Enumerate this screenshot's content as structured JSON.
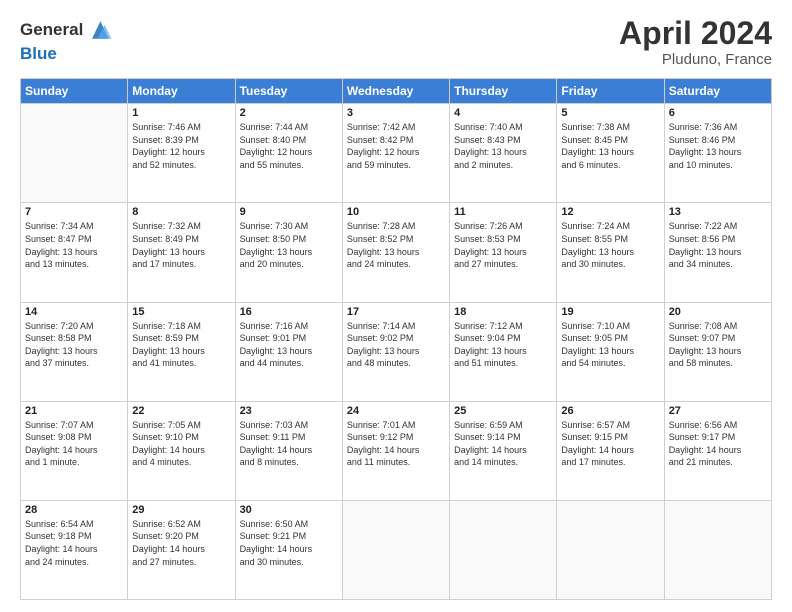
{
  "header": {
    "logo_general": "General",
    "logo_blue": "Blue",
    "month": "April 2024",
    "location": "Pluduno, France"
  },
  "weekdays": [
    "Sunday",
    "Monday",
    "Tuesday",
    "Wednesday",
    "Thursday",
    "Friday",
    "Saturday"
  ],
  "weeks": [
    [
      {
        "day": "",
        "info": ""
      },
      {
        "day": "1",
        "info": "Sunrise: 7:46 AM\nSunset: 8:39 PM\nDaylight: 12 hours\nand 52 minutes."
      },
      {
        "day": "2",
        "info": "Sunrise: 7:44 AM\nSunset: 8:40 PM\nDaylight: 12 hours\nand 55 minutes."
      },
      {
        "day": "3",
        "info": "Sunrise: 7:42 AM\nSunset: 8:42 PM\nDaylight: 12 hours\nand 59 minutes."
      },
      {
        "day": "4",
        "info": "Sunrise: 7:40 AM\nSunset: 8:43 PM\nDaylight: 13 hours\nand 2 minutes."
      },
      {
        "day": "5",
        "info": "Sunrise: 7:38 AM\nSunset: 8:45 PM\nDaylight: 13 hours\nand 6 minutes."
      },
      {
        "day": "6",
        "info": "Sunrise: 7:36 AM\nSunset: 8:46 PM\nDaylight: 13 hours\nand 10 minutes."
      }
    ],
    [
      {
        "day": "7",
        "info": "Sunrise: 7:34 AM\nSunset: 8:47 PM\nDaylight: 13 hours\nand 13 minutes."
      },
      {
        "day": "8",
        "info": "Sunrise: 7:32 AM\nSunset: 8:49 PM\nDaylight: 13 hours\nand 17 minutes."
      },
      {
        "day": "9",
        "info": "Sunrise: 7:30 AM\nSunset: 8:50 PM\nDaylight: 13 hours\nand 20 minutes."
      },
      {
        "day": "10",
        "info": "Sunrise: 7:28 AM\nSunset: 8:52 PM\nDaylight: 13 hours\nand 24 minutes."
      },
      {
        "day": "11",
        "info": "Sunrise: 7:26 AM\nSunset: 8:53 PM\nDaylight: 13 hours\nand 27 minutes."
      },
      {
        "day": "12",
        "info": "Sunrise: 7:24 AM\nSunset: 8:55 PM\nDaylight: 13 hours\nand 30 minutes."
      },
      {
        "day": "13",
        "info": "Sunrise: 7:22 AM\nSunset: 8:56 PM\nDaylight: 13 hours\nand 34 minutes."
      }
    ],
    [
      {
        "day": "14",
        "info": "Sunrise: 7:20 AM\nSunset: 8:58 PM\nDaylight: 13 hours\nand 37 minutes."
      },
      {
        "day": "15",
        "info": "Sunrise: 7:18 AM\nSunset: 8:59 PM\nDaylight: 13 hours\nand 41 minutes."
      },
      {
        "day": "16",
        "info": "Sunrise: 7:16 AM\nSunset: 9:01 PM\nDaylight: 13 hours\nand 44 minutes."
      },
      {
        "day": "17",
        "info": "Sunrise: 7:14 AM\nSunset: 9:02 PM\nDaylight: 13 hours\nand 48 minutes."
      },
      {
        "day": "18",
        "info": "Sunrise: 7:12 AM\nSunset: 9:04 PM\nDaylight: 13 hours\nand 51 minutes."
      },
      {
        "day": "19",
        "info": "Sunrise: 7:10 AM\nSunset: 9:05 PM\nDaylight: 13 hours\nand 54 minutes."
      },
      {
        "day": "20",
        "info": "Sunrise: 7:08 AM\nSunset: 9:07 PM\nDaylight: 13 hours\nand 58 minutes."
      }
    ],
    [
      {
        "day": "21",
        "info": "Sunrise: 7:07 AM\nSunset: 9:08 PM\nDaylight: 14 hours\nand 1 minute."
      },
      {
        "day": "22",
        "info": "Sunrise: 7:05 AM\nSunset: 9:10 PM\nDaylight: 14 hours\nand 4 minutes."
      },
      {
        "day": "23",
        "info": "Sunrise: 7:03 AM\nSunset: 9:11 PM\nDaylight: 14 hours\nand 8 minutes."
      },
      {
        "day": "24",
        "info": "Sunrise: 7:01 AM\nSunset: 9:12 PM\nDaylight: 14 hours\nand 11 minutes."
      },
      {
        "day": "25",
        "info": "Sunrise: 6:59 AM\nSunset: 9:14 PM\nDaylight: 14 hours\nand 14 minutes."
      },
      {
        "day": "26",
        "info": "Sunrise: 6:57 AM\nSunset: 9:15 PM\nDaylight: 14 hours\nand 17 minutes."
      },
      {
        "day": "27",
        "info": "Sunrise: 6:56 AM\nSunset: 9:17 PM\nDaylight: 14 hours\nand 21 minutes."
      }
    ],
    [
      {
        "day": "28",
        "info": "Sunrise: 6:54 AM\nSunset: 9:18 PM\nDaylight: 14 hours\nand 24 minutes."
      },
      {
        "day": "29",
        "info": "Sunrise: 6:52 AM\nSunset: 9:20 PM\nDaylight: 14 hours\nand 27 minutes."
      },
      {
        "day": "30",
        "info": "Sunrise: 6:50 AM\nSunset: 9:21 PM\nDaylight: 14 hours\nand 30 minutes."
      },
      {
        "day": "",
        "info": ""
      },
      {
        "day": "",
        "info": ""
      },
      {
        "day": "",
        "info": ""
      },
      {
        "day": "",
        "info": ""
      }
    ]
  ]
}
